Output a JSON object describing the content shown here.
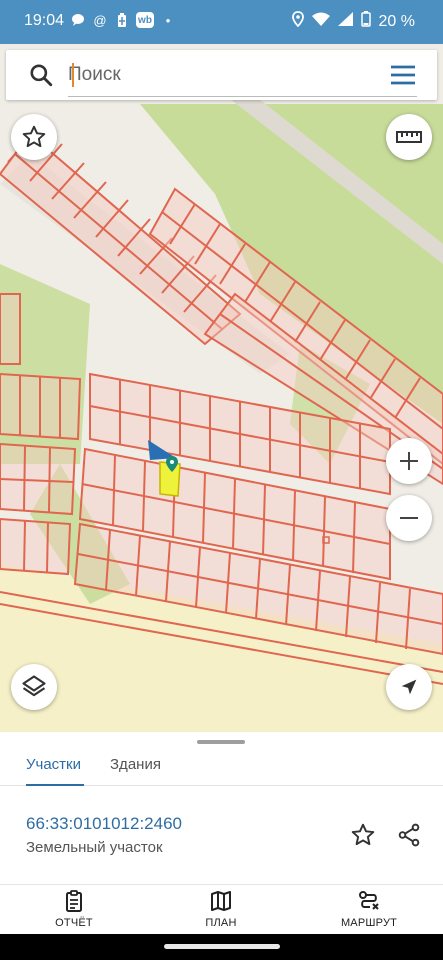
{
  "status_bar": {
    "time": "19:04",
    "notification_icons": [
      "message-bubble-icon",
      "at-sign-icon",
      "battery-saver-icon",
      "wb-app-icon",
      "dot-icon"
    ],
    "wb_label": "wb",
    "battery_percent": "20 %"
  },
  "search": {
    "placeholder": "Поиск"
  },
  "map": {
    "background_color": "#f0ede7",
    "forest_color": "#c8dc9a",
    "field_color": "#f5f0c8",
    "parcel_line_color": "#e0664f",
    "selected_parcel_color": "#eef23a",
    "buttons": [
      "favorite-star",
      "ruler",
      "zoom-in",
      "zoom-out",
      "layers",
      "my-location"
    ]
  },
  "sheet": {
    "tabs": [
      {
        "label": "Участки",
        "active": true
      },
      {
        "label": "Здания",
        "active": false
      }
    ],
    "parcel": {
      "cadastral_number": "66:33:0101012:2460",
      "type": "Земельный участок"
    }
  },
  "bottom_nav": [
    {
      "label": "ОТЧЁТ",
      "icon": "report-clipboard-icon"
    },
    {
      "label": "ПЛАН",
      "icon": "map-plan-icon"
    },
    {
      "label": "МАРШРУТ",
      "icon": "route-icon"
    }
  ],
  "colors": {
    "status_bar": "#4c8fc1",
    "accent": "#2e6da4",
    "location_arrow": "#2a6fb3"
  }
}
